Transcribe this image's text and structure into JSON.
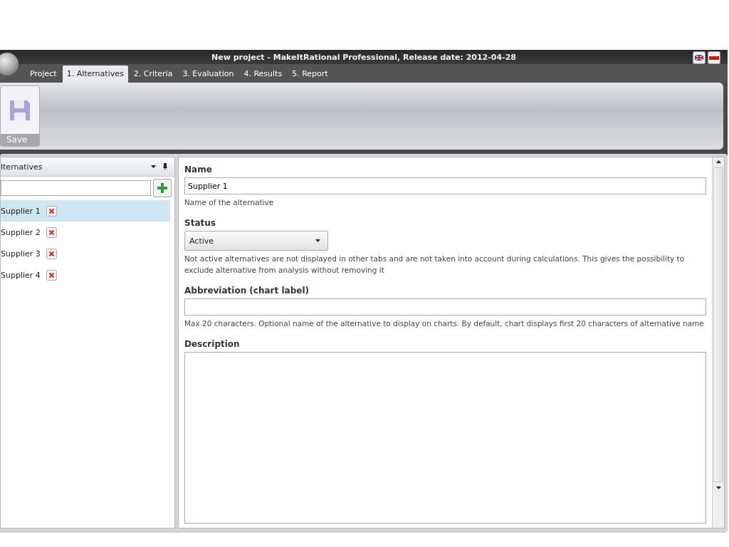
{
  "window": {
    "title": "New project - MakeItRational Professional, Release date: 2012-04-28"
  },
  "tabs": [
    {
      "label": "Project",
      "selected": false
    },
    {
      "label": "1. Alternatives",
      "selected": true
    },
    {
      "label": "2. Criteria",
      "selected": false
    },
    {
      "label": "3. Evaluation",
      "selected": false
    },
    {
      "label": "4. Results",
      "selected": false
    },
    {
      "label": "5. Report",
      "selected": false
    }
  ],
  "ribbon": {
    "buttons": [
      {
        "label": "Save"
      }
    ]
  },
  "alternatives_panel": {
    "title": "lternatives",
    "items": [
      {
        "label": "Supplier 1",
        "selected": true
      },
      {
        "label": "Supplier 2",
        "selected": false
      },
      {
        "label": "Supplier 3",
        "selected": false
      },
      {
        "label": "Supplier 4",
        "selected": false
      }
    ]
  },
  "form": {
    "fields": [
      {
        "kind": "text",
        "label": "Name",
        "value": "Supplier 1",
        "hint": "Name of the alternative"
      },
      {
        "kind": "select",
        "label": "Status",
        "value": "Active",
        "hint": "Not active alternatives are not displayed in other tabs and are not taken into account during calculations. This gives the possibility to exclude alternative from analysis without removing it"
      },
      {
        "kind": "text",
        "label": "Abbreviation (chart label)",
        "hint": "Max 20 characters. Optional name of the alternative to display on charts. By default, chart displays first 20 characters of alternative name"
      },
      {
        "kind": "textarea",
        "label": "Description"
      }
    ]
  }
}
